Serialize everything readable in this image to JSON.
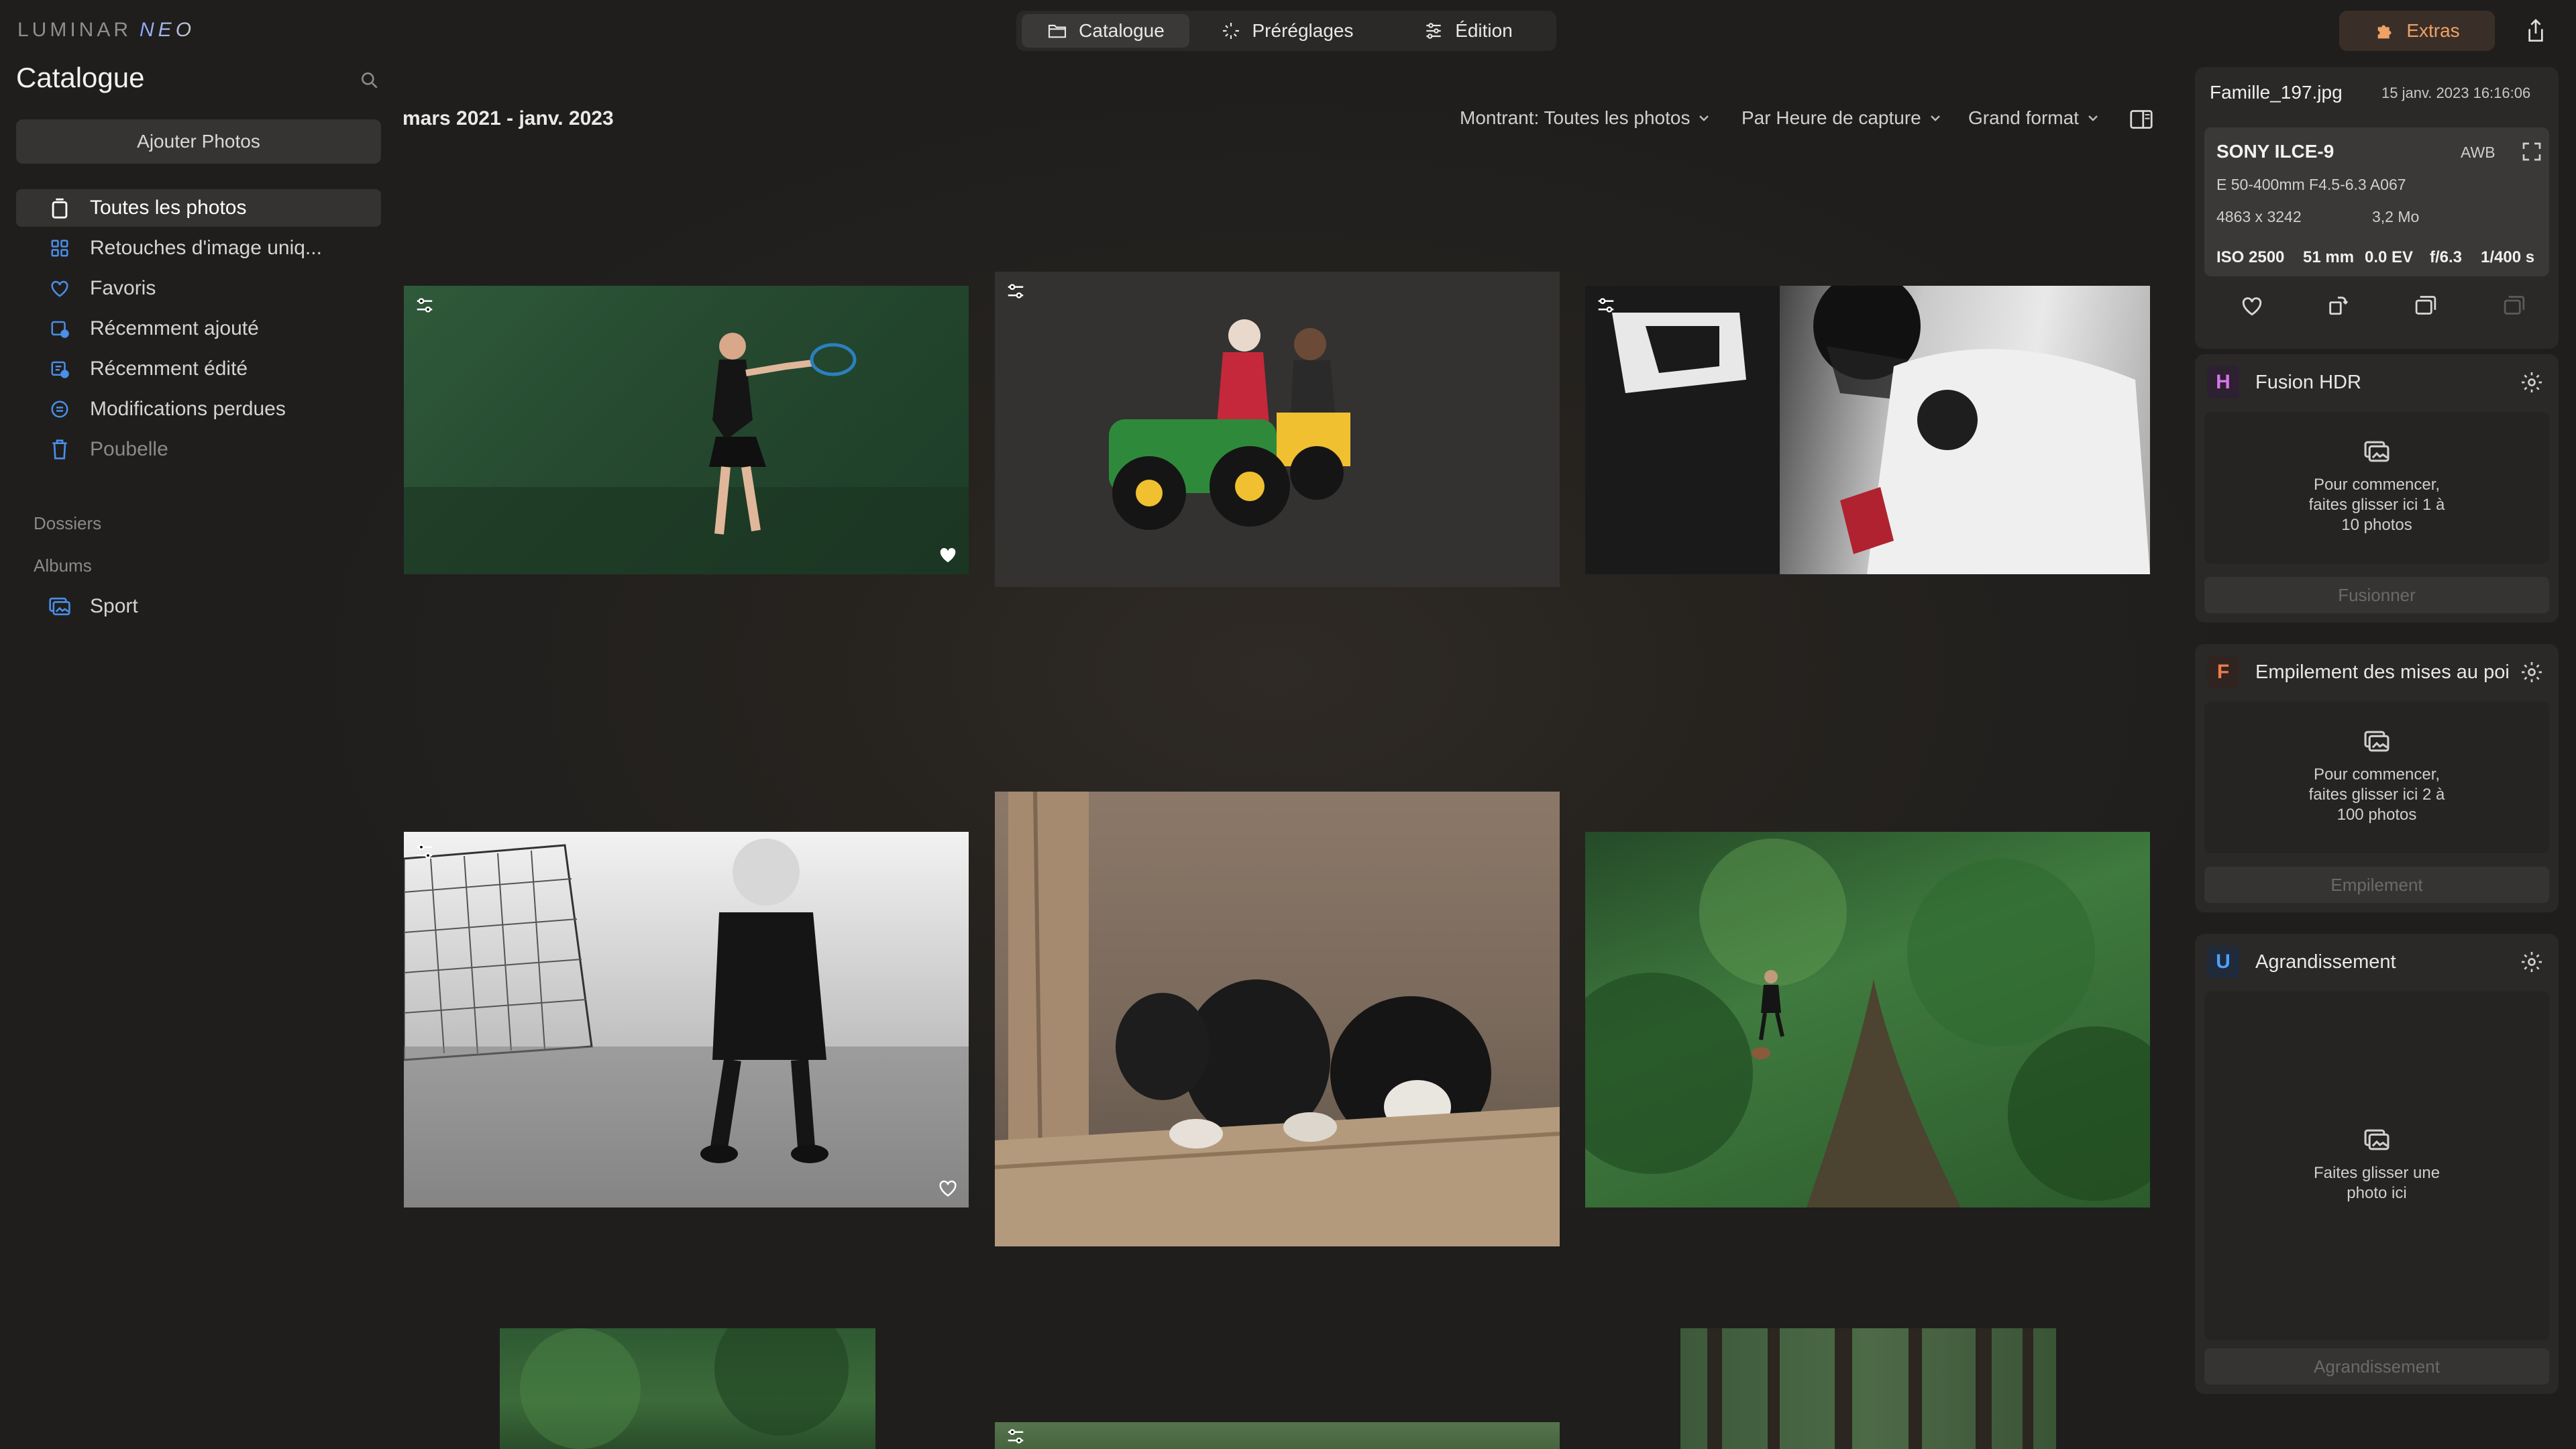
{
  "app": {
    "logo_part1": "LUMINAR",
    "logo_part2": "NEO"
  },
  "top_tabs": [
    {
      "label": "Catalogue",
      "icon": "folder-icon",
      "active": true
    },
    {
      "label": "Préréglages",
      "icon": "sparkle-icon",
      "active": false
    },
    {
      "label": "Édition",
      "icon": "sliders-icon",
      "active": false
    }
  ],
  "extras": {
    "label": "Extras",
    "icon": "puzzle-icon",
    "color": "#f0a165"
  },
  "sidebar": {
    "title": "Catalogue",
    "add_button": "Ajouter Photos",
    "items": [
      {
        "label": "Toutes les photos",
        "icon": "photos-icon",
        "active": true
      },
      {
        "label": "Retouches d'image uniq...",
        "icon": "grid-icon"
      },
      {
        "label": "Favoris",
        "icon": "heart-icon"
      },
      {
        "label": "Récemment ajouté",
        "icon": "recent-added-icon"
      },
      {
        "label": "Récemment édité",
        "icon": "recent-edited-icon"
      },
      {
        "label": "Modifications perdues",
        "icon": "lost-edits-icon"
      },
      {
        "label": "Poubelle",
        "icon": "trash-icon"
      }
    ],
    "folders_label": "Dossiers",
    "albums_label": "Albums",
    "albums": [
      {
        "label": "Sport",
        "icon": "album-icon"
      }
    ]
  },
  "content": {
    "date_range": "mars 2021 - janv. 2023",
    "filter_showing": "Montrant: Toutes les photos",
    "filter_sort": "Par Heure de capture",
    "filter_view": "Grand format"
  },
  "info": {
    "file_name": "Famille_197.jpg",
    "file_date": "15 janv. 2023 16:16:06",
    "camera": "SONY ILCE-9",
    "white_balance": "AWB",
    "lens": "E 50-400mm F4.5-6.3 A067",
    "dimensions": "4863 x 3242",
    "size": "3,2 Mo",
    "iso": "ISO 2500",
    "focal": "51 mm",
    "ev": "0.0 EV",
    "aperture": "f/6.3",
    "shutter": "1/400 s"
  },
  "tools": [
    {
      "title": "Fusion HDR",
      "badge": "H",
      "badge_color": "#c04fd6",
      "drop_text": [
        "Pour commencer,",
        "faites glisser ici 1 à",
        "10 photos"
      ],
      "button": "Fusionner"
    },
    {
      "title": "Empilement des mises au point",
      "badge": "F",
      "badge_color": "#e8673a",
      "drop_text": [
        "Pour commencer,",
        "faites glisser ici 2 à",
        "100 photos"
      ],
      "button": "Empilement"
    },
    {
      "title": "Agrandissement",
      "badge": "U",
      "badge_color": "#3d7de6",
      "drop_text": [
        "Faites glisser une",
        "photo ici"
      ],
      "button": "Agrandissement"
    }
  ],
  "accent_color": "#4a8fe8"
}
